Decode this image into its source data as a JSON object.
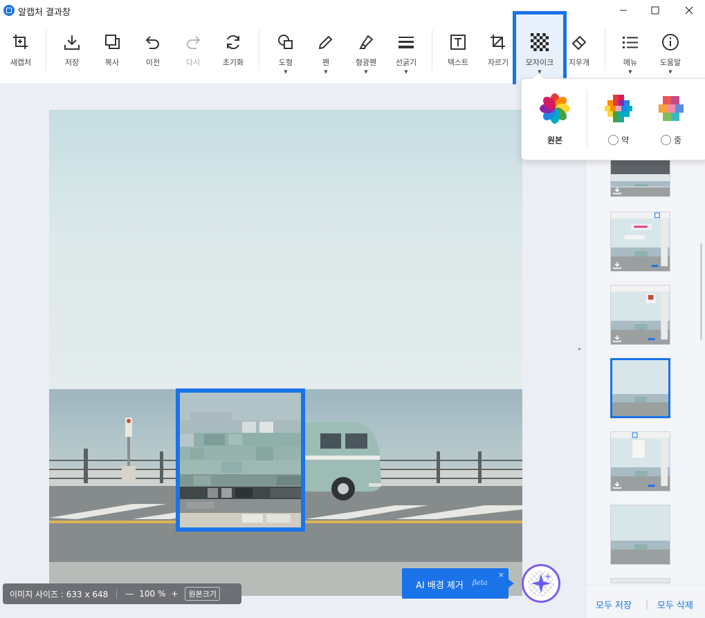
{
  "window": {
    "title": "알캡처 결과창",
    "controls": [
      "minimize",
      "maximize",
      "close"
    ]
  },
  "toolbar": {
    "tools": [
      {
        "id": "new-capture",
        "label": "새캡처",
        "icon": "crop-plus-icon"
      },
      {
        "id": "save",
        "label": "저장",
        "icon": "download-icon"
      },
      {
        "id": "copy",
        "label": "복사",
        "icon": "copy-icon"
      },
      {
        "id": "undo",
        "label": "이전",
        "icon": "undo-icon"
      },
      {
        "id": "redo",
        "label": "다시",
        "icon": "redo-icon",
        "disabled": true
      },
      {
        "id": "reset",
        "label": "초기화",
        "icon": "refresh-icon"
      },
      {
        "id": "shape",
        "label": "도형",
        "icon": "shapes-icon",
        "dropdown": true
      },
      {
        "id": "pen",
        "label": "펜",
        "icon": "pen-icon",
        "dropdown": true
      },
      {
        "id": "highlighter",
        "label": "형광펜",
        "icon": "highlighter-icon",
        "dropdown": true
      },
      {
        "id": "line-width",
        "label": "선굵기",
        "icon": "line-width-icon",
        "dropdown": true
      },
      {
        "id": "text",
        "label": "텍스트",
        "icon": "text-icon"
      },
      {
        "id": "crop",
        "label": "자르기",
        "icon": "crop-icon"
      },
      {
        "id": "mosaic",
        "label": "모자이크",
        "icon": "mosaic-icon",
        "dropdown": true,
        "active": true
      },
      {
        "id": "eraser",
        "label": "지우개",
        "icon": "eraser-icon"
      },
      {
        "id": "menu",
        "label": "메뉴",
        "icon": "list-icon",
        "dropdown": true
      },
      {
        "id": "help",
        "label": "도움말",
        "icon": "info-icon",
        "dropdown": true
      }
    ]
  },
  "mosaic_popup": {
    "options": [
      {
        "label": "원본",
        "has_radio": false
      },
      {
        "label": "약",
        "has_radio": true,
        "selected": false
      },
      {
        "label": "중",
        "has_radio": true,
        "selected": false
      }
    ]
  },
  "status": {
    "image_size": "이미지 사이즈 : 633 x 648",
    "zoom_out": "—",
    "zoom": "100 %",
    "zoom_in": "+",
    "original_size_button": "원본크기"
  },
  "ai_tip": {
    "label": "AI 배경 제거",
    "beta": "βeta",
    "close": "×"
  },
  "side_panel": {
    "thumbnail_count": 6,
    "selected_index": 3,
    "save_all": "모두 저장",
    "separator": "|",
    "delete_all": "모두 삭제"
  },
  "colors": {
    "accent": "#1a73e8",
    "ai_ring": "#7b5cf0",
    "status_bg": "#6d6f75"
  }
}
